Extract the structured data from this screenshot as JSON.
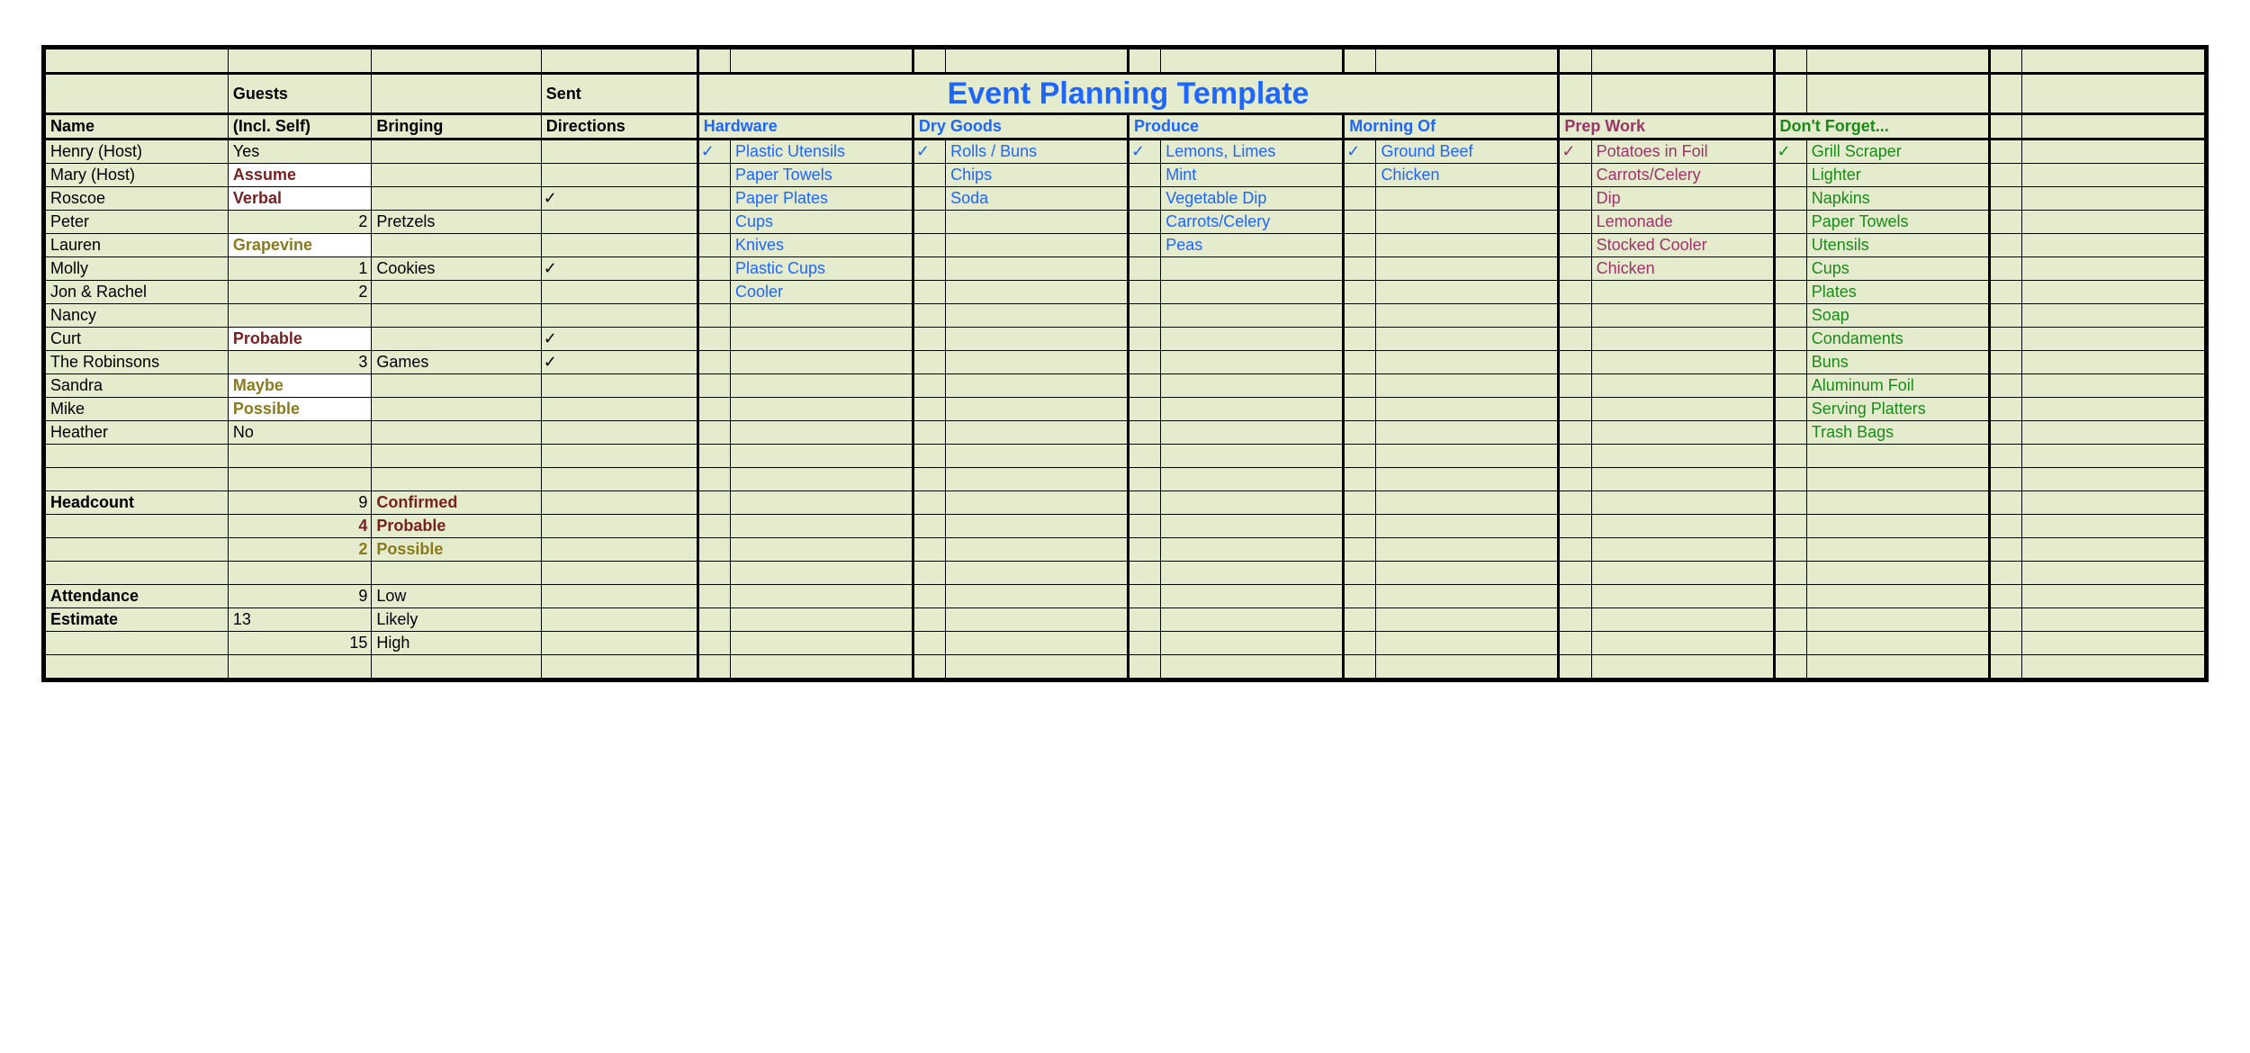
{
  "title": "Event Planning Template",
  "hdr": {
    "guests": "Guests",
    "sent": "Sent",
    "name": "Name",
    "incl": "(Incl. Self)",
    "bring": "Bringing",
    "dir": "Directions",
    "hw": "Hardware",
    "dg": "Dry Goods",
    "pr": "Produce",
    "mo": "Morning Of",
    "pw": "Prep Work",
    "df": "Don't Forget..."
  },
  "guests": [
    {
      "name": "Henry (Host)",
      "incl": "Yes",
      "bring": "",
      "dir": ""
    },
    {
      "name": "Mary (Host)",
      "incl": "Assume",
      "inclCls": "red white-bg",
      "bring": "",
      "dir": ""
    },
    {
      "name": "Roscoe",
      "incl": "Verbal",
      "inclCls": "red white-bg",
      "bring": "",
      "dir": "✓"
    },
    {
      "name": "Peter",
      "incl": "2",
      "inclCls": "num",
      "bring": "Pretzels",
      "dir": ""
    },
    {
      "name": "Lauren",
      "incl": "Grapevine",
      "inclCls": "olive white-bg",
      "bring": "",
      "dir": ""
    },
    {
      "name": "Molly",
      "incl": "1",
      "inclCls": "num",
      "bring": "Cookies",
      "dir": "✓"
    },
    {
      "name": "Jon & Rachel",
      "incl": "2",
      "inclCls": "num",
      "bring": "",
      "dir": ""
    },
    {
      "name": "Nancy",
      "incl": "",
      "bring": "",
      "dir": ""
    },
    {
      "name": "Curt",
      "incl": "Probable",
      "inclCls": "red white-bg",
      "bring": "",
      "dir": "✓"
    },
    {
      "name": "The Robinsons",
      "incl": "3",
      "inclCls": "num",
      "bring": "Games",
      "dir": "✓"
    },
    {
      "name": "Sandra",
      "incl": "Maybe",
      "inclCls": "olive white-bg",
      "bring": "",
      "dir": ""
    },
    {
      "name": "Mike",
      "incl": "Possible",
      "inclCls": "olive white-bg",
      "bring": "",
      "dir": ""
    },
    {
      "name": "Heather",
      "incl": "No",
      "bring": "",
      "dir": ""
    }
  ],
  "lists": {
    "hw": [
      "Plastic Utensils",
      "Paper Towels",
      "Paper Plates",
      "Cups",
      "Knives",
      "Plastic Cups",
      "Cooler"
    ],
    "dg": [
      "Rolls / Buns",
      "Chips",
      "Soda"
    ],
    "pr": [
      "Lemons, Limes",
      "Mint",
      "Vegetable Dip",
      "Carrots/Celery",
      "Peas"
    ],
    "mo": [
      "Ground Beef",
      "Chicken"
    ],
    "pw": [
      "Potatoes in Foil",
      "Carrots/Celery",
      "Dip",
      "Lemonade",
      "Stocked Cooler",
      "Chicken"
    ],
    "df": [
      "Grill Scraper",
      "Lighter",
      "Napkins",
      "Paper Towels",
      "Utensils",
      "Cups",
      "Plates",
      "Soap",
      "Condaments",
      "Buns",
      "Aluminum Foil",
      "Serving Platters",
      "Trash Bags"
    ]
  },
  "checks": {
    "hw": [
      true
    ],
    "dg": [
      true
    ],
    "pr": [
      true
    ],
    "mo": [
      true
    ],
    "pw": [
      true
    ],
    "df": [
      true
    ]
  },
  "summary": {
    "headcount": "Headcount",
    "hc9": "9",
    "hcConf": "Confirmed",
    "hc4": "4",
    "hcProb": "Probable",
    "hc2": "2",
    "hcPoss": "Possible",
    "attend": "Attendance",
    "att9": "9",
    "attLow": "Low",
    "est": "Estimate",
    "est13": "13",
    "estLikely": "Likely",
    "est15": "15",
    "estHigh": "High"
  }
}
